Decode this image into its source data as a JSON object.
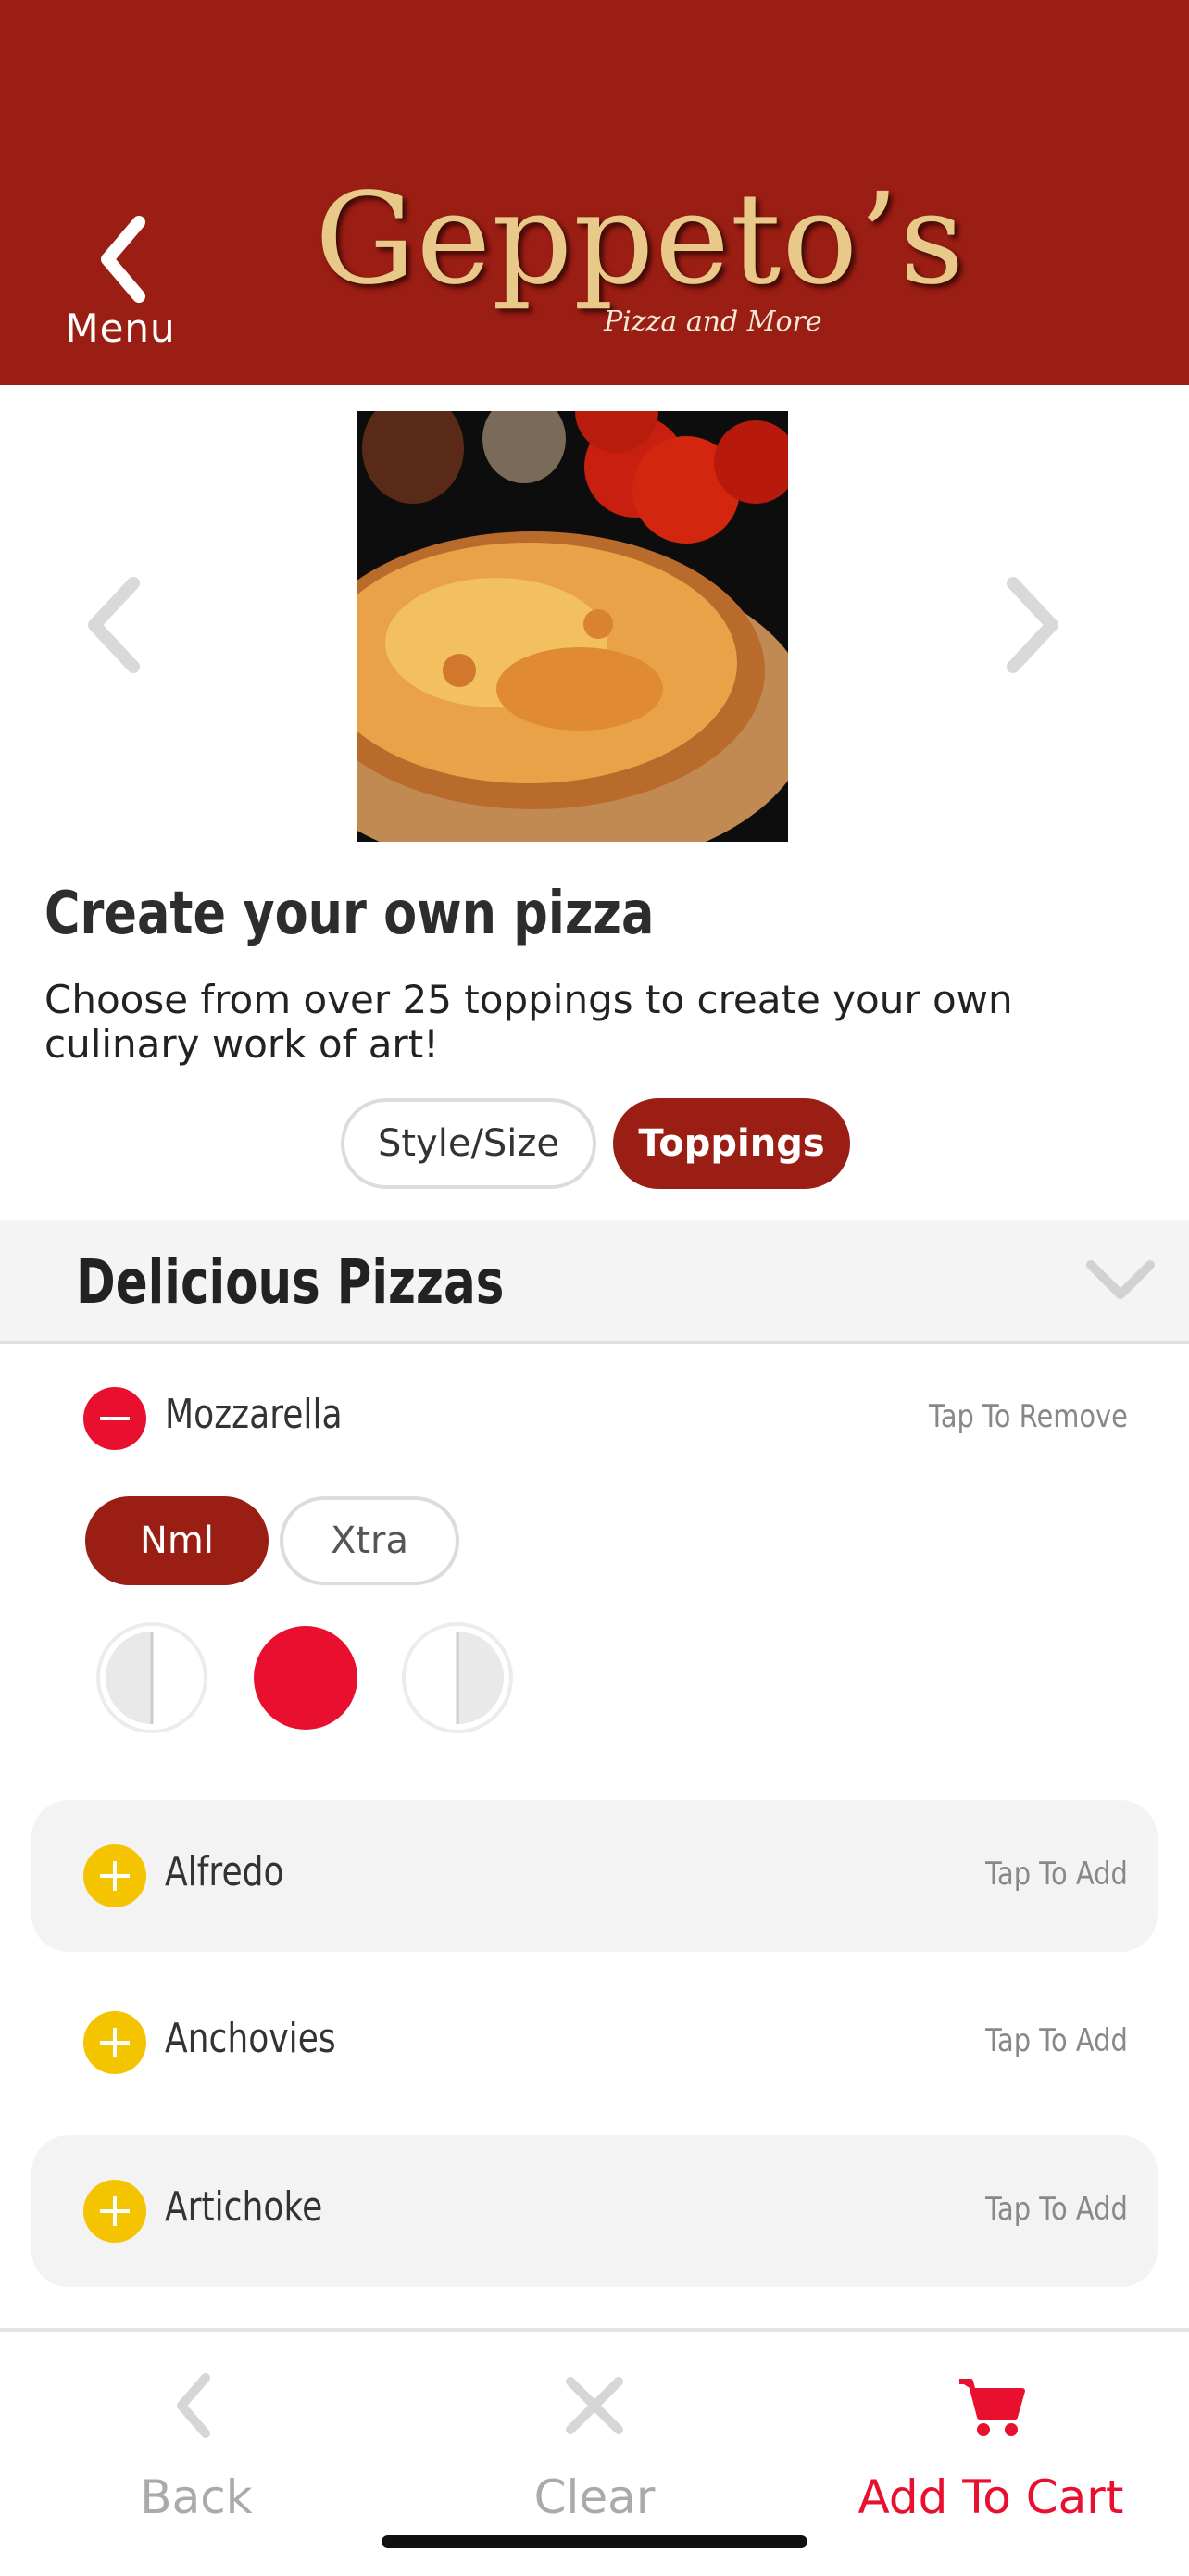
{
  "header": {
    "back_label": "Menu",
    "brand": "Geppeto’s",
    "brand_sub": "Pizza and More",
    "color": "#9b1e14"
  },
  "product": {
    "title": "Create your own pizza",
    "description": "Choose from over 25 toppings to create your own culinary work of art!",
    "tabs": [
      "Style/Size",
      "Toppings"
    ],
    "active_tab": "Toppings"
  },
  "section": {
    "title": "Delicious Pizzas"
  },
  "toppings": [
    {
      "name": "Mozzarella",
      "action": "Tap To Remove",
      "selected": true
    },
    {
      "name": "Alfredo",
      "action": "Tap To Add",
      "selected": false
    },
    {
      "name": "Anchovies",
      "action": "Tap To Add",
      "selected": false
    },
    {
      "name": "Artichoke",
      "action": "Tap To Add",
      "selected": false
    }
  ],
  "amount": {
    "options": [
      "Nml",
      "Xtra"
    ],
    "selected": "Nml"
  },
  "portion": {
    "options": [
      "left-half",
      "whole",
      "right-half"
    ],
    "selected": "whole"
  },
  "bottom_nav": {
    "back": "Back",
    "clear": "Clear",
    "add_to_cart": "Add To Cart"
  },
  "colors": {
    "accent": "#9b1e14",
    "remove": "#e8102e",
    "add": "#f5c400",
    "cart": "#e8102e"
  }
}
